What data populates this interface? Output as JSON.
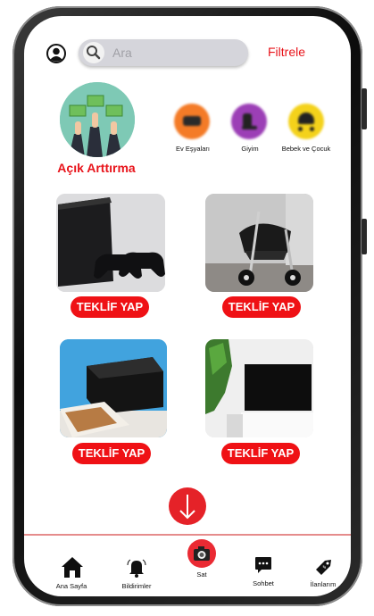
{
  "header": {
    "search_placeholder": "Ara",
    "filter_label": "Filtrele"
  },
  "auction": {
    "label": "Açık Arttırma"
  },
  "categories": [
    {
      "label": "Ev Eşyaları",
      "color": "#f47b27"
    },
    {
      "label": "Giyim",
      "color": "#9c3fb6"
    },
    {
      "label": "Bebek ve Çocuk",
      "color": "#f4d21b"
    }
  ],
  "products": [
    {
      "name": "playstation-console",
      "offer_label": "TEKLİF YAP"
    },
    {
      "name": "baby-stroller",
      "offer_label": "TEKLİF YAP"
    },
    {
      "name": "printer",
      "offer_label": "TEKLİF YAP"
    },
    {
      "name": "television",
      "offer_label": "TEKLİF YAP"
    }
  ],
  "bottom_nav": [
    {
      "label": "Ana Sayfa",
      "icon": "home-icon"
    },
    {
      "label": "Bildirimler",
      "icon": "bell-icon"
    },
    {
      "label": "Sat",
      "icon": "camera-icon"
    },
    {
      "label": "Sohbet",
      "icon": "chat-icon"
    },
    {
      "label": "İlanlarım",
      "icon": "tag-icon"
    }
  ],
  "colors": {
    "accent": "#e8141b",
    "offer_button": "#ef1115"
  }
}
